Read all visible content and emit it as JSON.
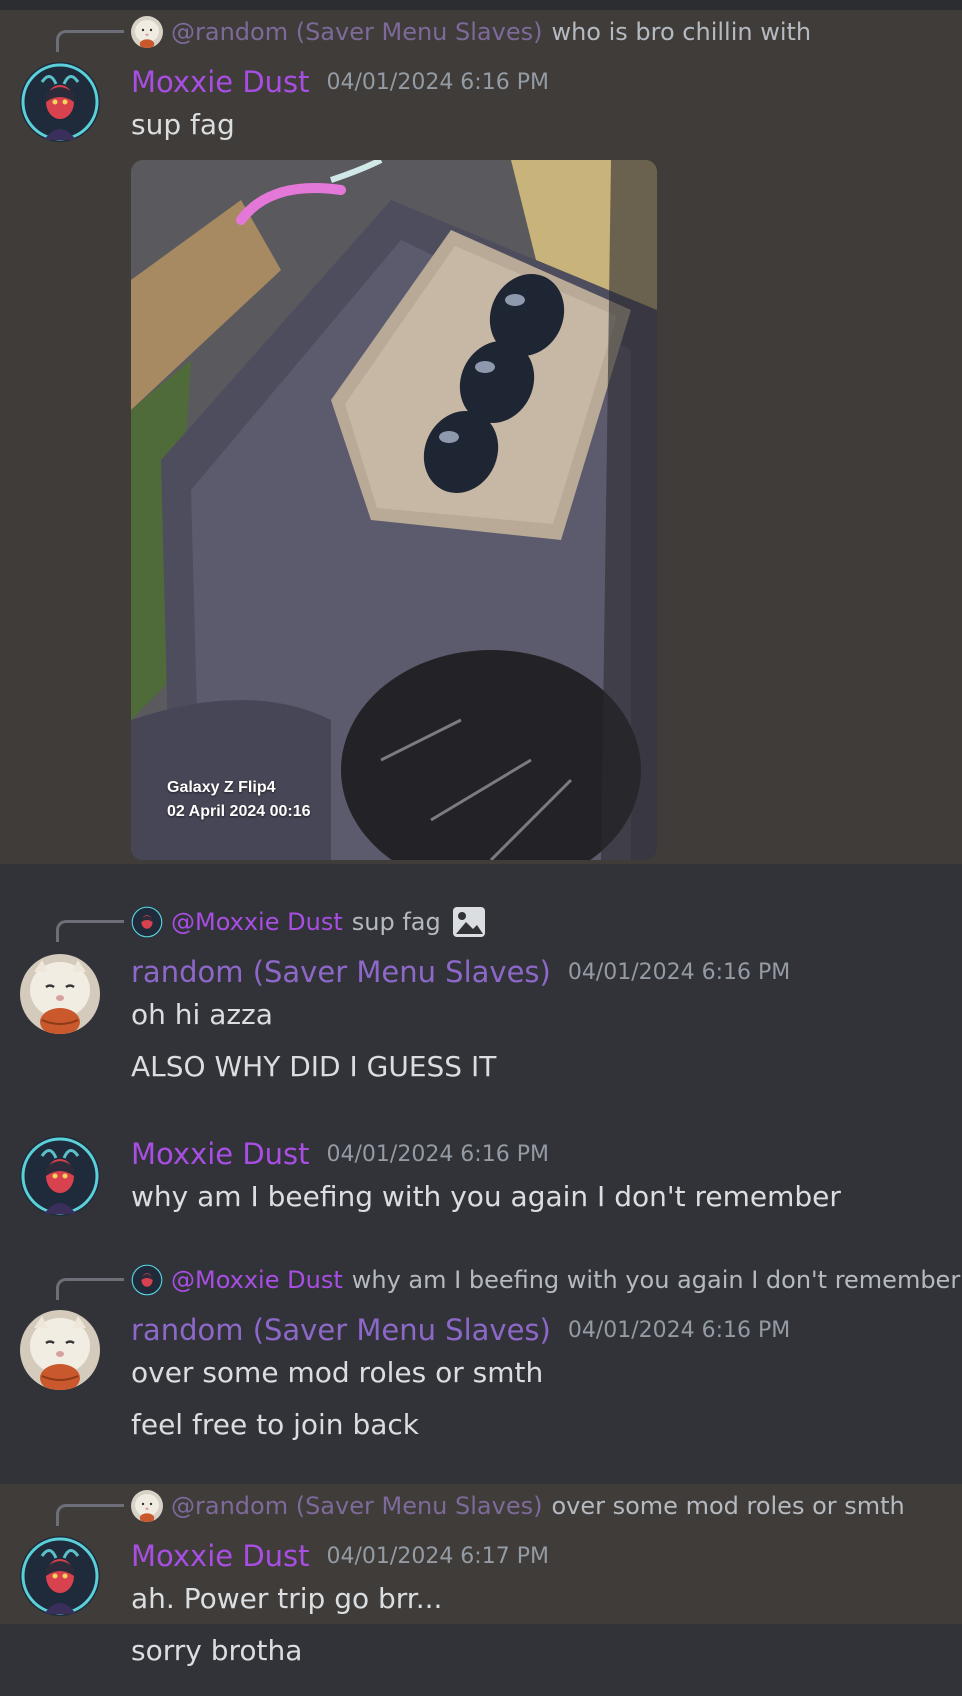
{
  "messages": [
    {
      "reply": {
        "name": "@random (Saver Menu Slaves)",
        "text": "who is bro chillin with"
      },
      "author": "Moxxie Dust",
      "timestamp": "04/01/2024 6:16 PM",
      "lines": [
        "sup fag"
      ],
      "attachment": {
        "camera_model": "Galaxy Z Flip4",
        "capture_date": "02 April 2024 00:16"
      }
    },
    {
      "reply": {
        "name": "@Moxxie Dust",
        "text": "sup fag",
        "icon": "image-icon"
      },
      "author": "random (Saver Menu Slaves)",
      "timestamp": "04/01/2024 6:16 PM",
      "lines": [
        "oh hi azza",
        "ALSO WHY DID I GUESS IT"
      ]
    },
    {
      "author": "Moxxie Dust",
      "timestamp": "04/01/2024 6:16 PM",
      "lines": [
        "why am I beefing with you again I don't remember"
      ]
    },
    {
      "reply": {
        "name": "@Moxxie Dust",
        "text": "why am I beefing with you again I don't remember"
      },
      "author": "random (Saver Menu Slaves)",
      "timestamp": "04/01/2024 6:16 PM",
      "lines": [
        "over some mod roles or smth",
        "feel free to join back"
      ]
    },
    {
      "reply": {
        "name": "@random (Saver Menu Slaves)",
        "text": "over some mod roles or smth"
      },
      "author": "Moxxie Dust",
      "timestamp": "04/01/2024 6:17 PM",
      "lines": [
        "ah. Power trip go brr...",
        "sorry brotha"
      ]
    }
  ],
  "colors": {
    "background": "#313338",
    "highlight": "#3f3c39",
    "moxxie_name": "#a84ee2",
    "random_name": "#8d68c9",
    "timestamp": "#949ba4",
    "text": "#dbdee1"
  }
}
